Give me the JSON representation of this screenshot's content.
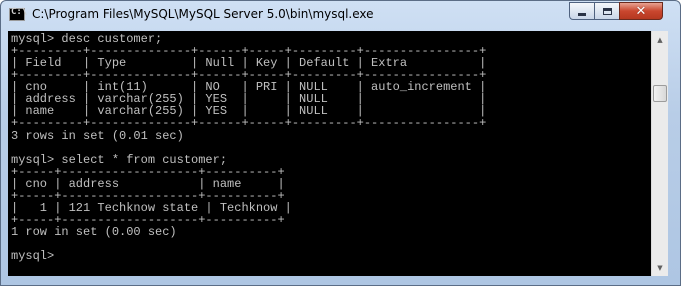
{
  "window": {
    "title": "C:\\Program Files\\MySQL\\MySQL Server 5.0\\bin\\mysql.exe"
  },
  "controls": {
    "minimize_icon": "minimize-icon",
    "maximize_icon": "maximize-icon",
    "close_icon": "close-icon",
    "close_glyph": "✕"
  },
  "console": {
    "lines": [
      "mysql> desc customer;",
      "+---------+--------------+------+-----+---------+----------------+",
      "| Field   | Type         | Null | Key | Default | Extra          |",
      "+---------+--------------+------+-----+---------+----------------+",
      "| cno     | int(11)      | NO   | PRI | NULL    | auto_increment |",
      "| address | varchar(255) | YES  |     | NULL    |                |",
      "| name    | varchar(255) | YES  |     | NULL    |                |",
      "+---------+--------------+------+-----+---------+----------------+",
      "3 rows in set (0.01 sec)",
      "",
      "mysql> select * from customer;",
      "+-----+-------------------+----------+",
      "| cno | address           | name     |",
      "+-----+-------------------+----------+",
      "|   1 | 121 Techknow state | Techknow |",
      "+-----+-------------------+----------+",
      "1 row in set (0.00 sec)",
      "",
      "mysql>"
    ]
  },
  "scrollbar": {
    "up_glyph": "▲",
    "down_glyph": "▼"
  },
  "colors": {
    "console_bg": "#000000",
    "console_text": "#c0c0c0",
    "close_button": "#c9472f"
  }
}
